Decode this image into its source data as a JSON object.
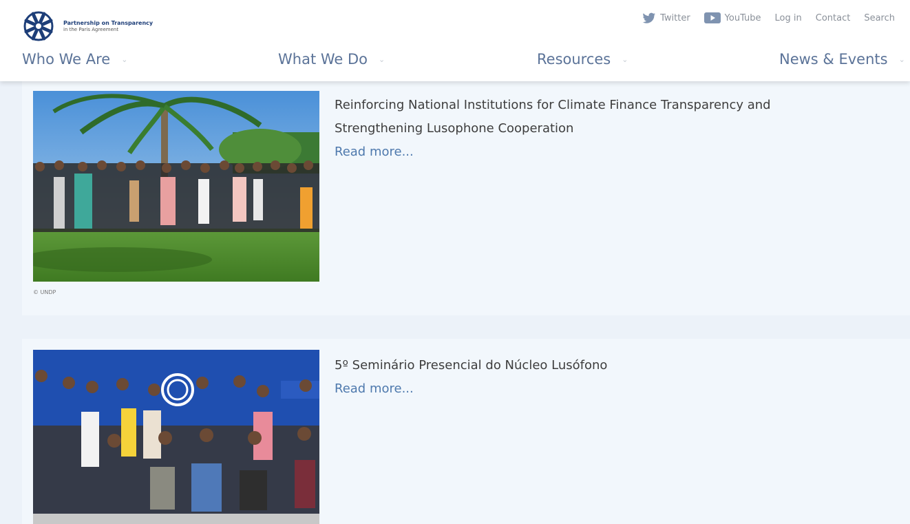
{
  "brand": {
    "title": "Partnership on Transparency",
    "subtitle": "in the Paris Agreement"
  },
  "top_links": {
    "twitter": "Twitter",
    "youtube": "YouTube",
    "login": "Log in",
    "contact": "Contact",
    "search": "Search"
  },
  "nav": [
    {
      "label": "Who We Are"
    },
    {
      "label": "What We Do"
    },
    {
      "label": "Resources"
    },
    {
      "label": "News & Events"
    }
  ],
  "articles": [
    {
      "title": "Reinforcing National Institutions for Climate Finance Transparency and Strengthening Lusophone Cooperation",
      "read_more": "Read more...",
      "caption": "© UNDP"
    },
    {
      "title": "5º Seminário Presencial do Núcleo Lusófono",
      "read_more": "Read more..."
    }
  ],
  "colors": {
    "nav_text": "#5b7398",
    "link": "#4e79ad",
    "page_bg": "#ecf2f9",
    "card_bg": "#f2f7fc"
  }
}
